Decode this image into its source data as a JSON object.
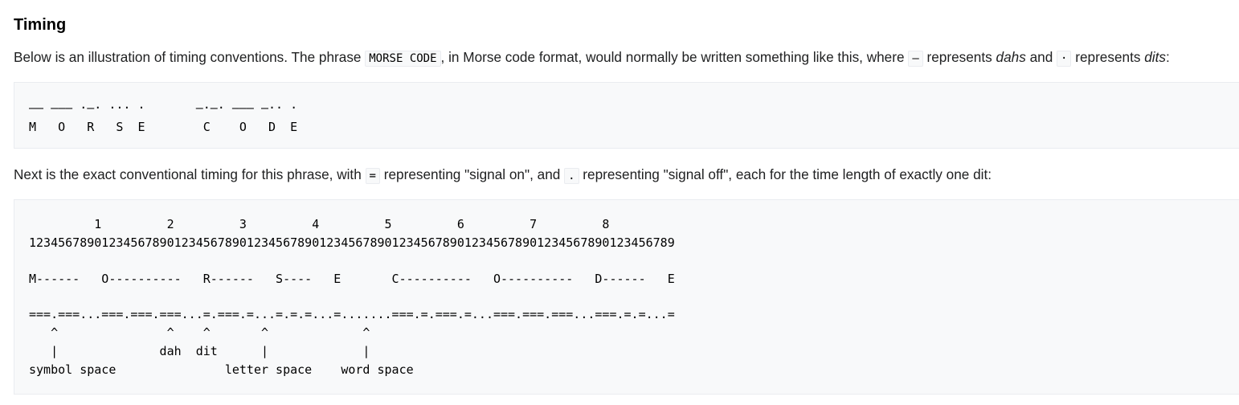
{
  "heading": "Timing",
  "intro": {
    "text_before_phrase": "Below is an illustration of timing conventions. The phrase ",
    "phrase_code": "MORSE CODE",
    "text_after_phrase": ", in Morse code format, would normally be written something like this, where ",
    "dah_code": "–",
    "text_represents_1": " represents ",
    "dahs_word": "dahs",
    "text_and": " and ",
    "dit_code": "·",
    "text_represents_2": " represents ",
    "dits_word": "dits",
    "text_end": ":"
  },
  "morse_block": {
    "line1": "–– ––– ·–· ··· ·       –·–· ––– –·· ·",
    "line2": "M   O   R   S  E        C    O   D  E"
  },
  "next": {
    "text_before_on": "Next is the exact conventional timing for this phrase, with ",
    "on_code": "=",
    "text_mid": " representing \"signal on\", and ",
    "off_code": ".",
    "text_end": " representing \"signal off\", each for the time length of exactly one dit:"
  },
  "timing_block": {
    "lines": [
      "         1         2         3         4         5         6         7         8",
      "12345678901234567890123456789012345678901234567890123456789012345678901234567890123456789",
      "",
      "M------   O----------   R------   S----   E       C----------   O----------   D------   E",
      "",
      "===.===...===.===.===...=.===.=...=.=.=...=.......===.=.===.=...===.===.===...===.=.=...=",
      "   ^               ^    ^       ^             ^",
      "   |              dah  dit      |             |",
      "symbol space               letter space    word space"
    ]
  }
}
